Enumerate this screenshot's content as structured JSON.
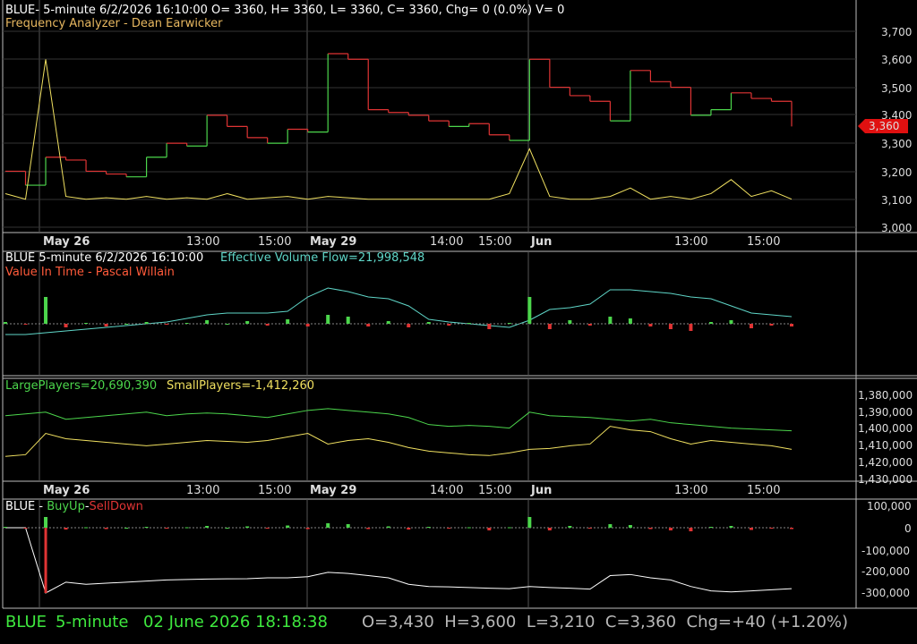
{
  "colors": {
    "background": "#000000",
    "grid": "#333333",
    "panel_border": "#bbbbbb",
    "up": "#4cd64c",
    "down": "#e03434",
    "yellow": "#f0e060",
    "cyan": "#5fd6c8",
    "white": "#ffffff",
    "orange": "#e8b860",
    "label_red": "#ff5a3a",
    "status_green": "#3ee83e",
    "status_grey": "#b8b8b8",
    "price_tag": "#e01010"
  },
  "panel1": {
    "header": "BLUE- 5-minute 6/2/2026 16:10:00 O= 3360, H= 3360, L= 3360, C= 3360, Chg= 0 (0.0%) V= 0",
    "indicator": "Frequency Analyzer - Dean Earwicker",
    "price_tag": "3,360",
    "y_ticks": [
      "3,700",
      "3,600",
      "3,500",
      "3,400",
      "3,300",
      "3,200",
      "3,100",
      "3,000"
    ]
  },
  "panel2": {
    "header_prefix": "BLUE 5-minute  6/2/2026 16:10:00",
    "header_flow": "Effective Volume Flow=21,998,548",
    "indicator": "Value In Time - Pascal Willain"
  },
  "panel3": {
    "large_label": "LargePlayers=20,690,390",
    "small_label": "SmallPlayers=-1,412,260",
    "y_ticks": [
      "1,380,000",
      "1,390,000",
      "1,400,000",
      "1,410,000",
      "1,420,000",
      "1,430,000"
    ]
  },
  "panel4": {
    "label_blue": "BLUE - ",
    "label_buyup": "BuyUp",
    "label_dash": "-",
    "label_selldown": "SellDown",
    "y_ticks": [
      "100,000",
      "0",
      "-100,000",
      "-200,000",
      "-300,000"
    ]
  },
  "date_axis": {
    "labels": [
      {
        "text": "May 26",
        "bold": true
      },
      {
        "text": "13:00",
        "bold": false
      },
      {
        "text": "15:00",
        "bold": false
      },
      {
        "text": "May 29",
        "bold": true
      },
      {
        "text": "14:00",
        "bold": false
      },
      {
        "text": "15:00",
        "bold": false
      },
      {
        "text": "Jun",
        "bold": true
      },
      {
        "text": "13:00",
        "bold": false
      },
      {
        "text": "15:00",
        "bold": false
      }
    ]
  },
  "status": {
    "symbol": "BLUE",
    "interval": "5-minute",
    "datetime": "02 June 2026 18:18:38",
    "ohlc": "O=3,430  H=3,600  L=3,210  C=3,360  Chg=+40 (+1.20%)"
  },
  "chart_data": [
    {
      "type": "line",
      "title": "BLUE- 5-minute 6/2/2026 16:10:00 O= 3360, H= 3360, L= 3360, C= 3360, Chg= 0 (0.0%) V= 0",
      "subtitle": "Frequency Analyzer - Dean Earwicker",
      "ylim": [
        3000,
        3700
      ],
      "series": [
        {
          "name": "",
          "color": "up/down step",
          "values": [
            3200,
            3150,
            3250,
            3240,
            3200,
            3190,
            3180,
            3250,
            3300,
            3290,
            3400,
            3360,
            3320,
            3300,
            3350,
            3340,
            3620,
            3600,
            3420,
            3410,
            3400,
            3380,
            3360,
            3370,
            3330,
            3310,
            3600,
            3500,
            3470,
            3450,
            3380,
            3560,
            3520,
            3500,
            3400,
            3420,
            3480,
            3460,
            3450,
            3360
          ]
        },
        {
          "name": "Frequency Analyzer",
          "color": "yellow",
          "values": [
            3120,
            3100,
            3600,
            3110,
            3100,
            3105,
            3100,
            3110,
            3100,
            3105,
            3100,
            3120,
            3100,
            3105,
            3110,
            3100,
            3110,
            3105,
            3100,
            3100,
            3100,
            3100,
            3100,
            3100,
            3100,
            3120,
            3280,
            3110,
            3100,
            3100,
            3110,
            3140,
            3100,
            3110,
            3100,
            3120,
            3170,
            3110,
            3130,
            3100
          ]
        }
      ],
      "grid": true
    },
    {
      "type": "line",
      "title": "Effective Volume Flow=21,998,548",
      "subtitle": "Value In Time - Pascal Willain",
      "series": [
        {
          "name": "Effective Volume Flow",
          "color": "cyan",
          "values": [
            -12,
            -12,
            -10,
            -8,
            -6,
            -4,
            -2,
            0,
            2,
            6,
            10,
            12,
            12,
            12,
            14,
            30,
            40,
            36,
            30,
            28,
            20,
            5,
            2,
            0,
            -2,
            -4,
            4,
            16,
            18,
            22,
            38,
            38,
            36,
            34,
            30,
            28,
            20,
            12,
            10,
            8
          ]
        },
        {
          "name": "Value In Time",
          "color": "up/down bars",
          "values": [
            2,
            -1,
            30,
            -4,
            1,
            -3,
            0,
            2,
            -1,
            1,
            4,
            0,
            3,
            -2,
            5,
            -3,
            10,
            8,
            -3,
            3,
            -4,
            2,
            -2,
            1,
            -6,
            1,
            30,
            -6,
            4,
            -2,
            8,
            6,
            -3,
            -6,
            -8,
            2,
            4,
            -5,
            -2,
            -3
          ]
        }
      ]
    },
    {
      "type": "line",
      "title": "LargePlayers=20,690,390",
      "ylim": [
        1430000,
        1380000
      ],
      "series": [
        {
          "name": "LargePlayers",
          "color": "green",
          "values": [
            1392000,
            1391000,
            1390000,
            1394000,
            1393000,
            1392000,
            1391000,
            1390000,
            1392000,
            1391000,
            1390500,
            1391000,
            1392000,
            1393000,
            1391000,
            1389000,
            1388000,
            1389000,
            1390000,
            1391000,
            1393000,
            1397000,
            1398000,
            1397500,
            1398000,
            1399000,
            1390000,
            1392000,
            1392500,
            1393000,
            1394000,
            1395000,
            1394000,
            1396000,
            1397000,
            1398000,
            1399000,
            1399500,
            1400000,
            1400500
          ]
        },
        {
          "name": "SmallPlayers",
          "color": "yellow",
          "values": [
            1415000,
            1414000,
            1402000,
            1405000,
            1406000,
            1407000,
            1408000,
            1409000,
            1408000,
            1407000,
            1406000,
            1406500,
            1407000,
            1406000,
            1404000,
            1402000,
            1408000,
            1406000,
            1405000,
            1407000,
            1410000,
            1412000,
            1413000,
            1414000,
            1414500,
            1413000,
            1411000,
            1410500,
            1409000,
            1408000,
            1398000,
            1400000,
            1401000,
            1405000,
            1408000,
            1406000,
            1407000,
            1408000,
            1409000,
            1411000
          ]
        }
      ]
    },
    {
      "type": "line",
      "title": "BLUE - BuyUp-SellDown",
      "ylim": [
        -330000,
        130000
      ],
      "series": [
        {
          "name": "BuyUp-SellDown",
          "color": "white",
          "values": [
            0,
            0,
            -300000,
            -250000,
            -260000,
            -255000,
            -250000,
            -245000,
            -240000,
            -238000,
            -236000,
            -235000,
            -234000,
            -230000,
            -230000,
            -225000,
            -205000,
            -210000,
            -220000,
            -230000,
            -260000,
            -270000,
            -272000,
            -275000,
            -278000,
            -280000,
            -270000,
            -275000,
            -278000,
            -282000,
            -220000,
            -215000,
            -230000,
            -240000,
            -270000,
            -290000,
            -295000,
            -290000,
            -285000,
            -280000
          ]
        }
      ]
    }
  ]
}
